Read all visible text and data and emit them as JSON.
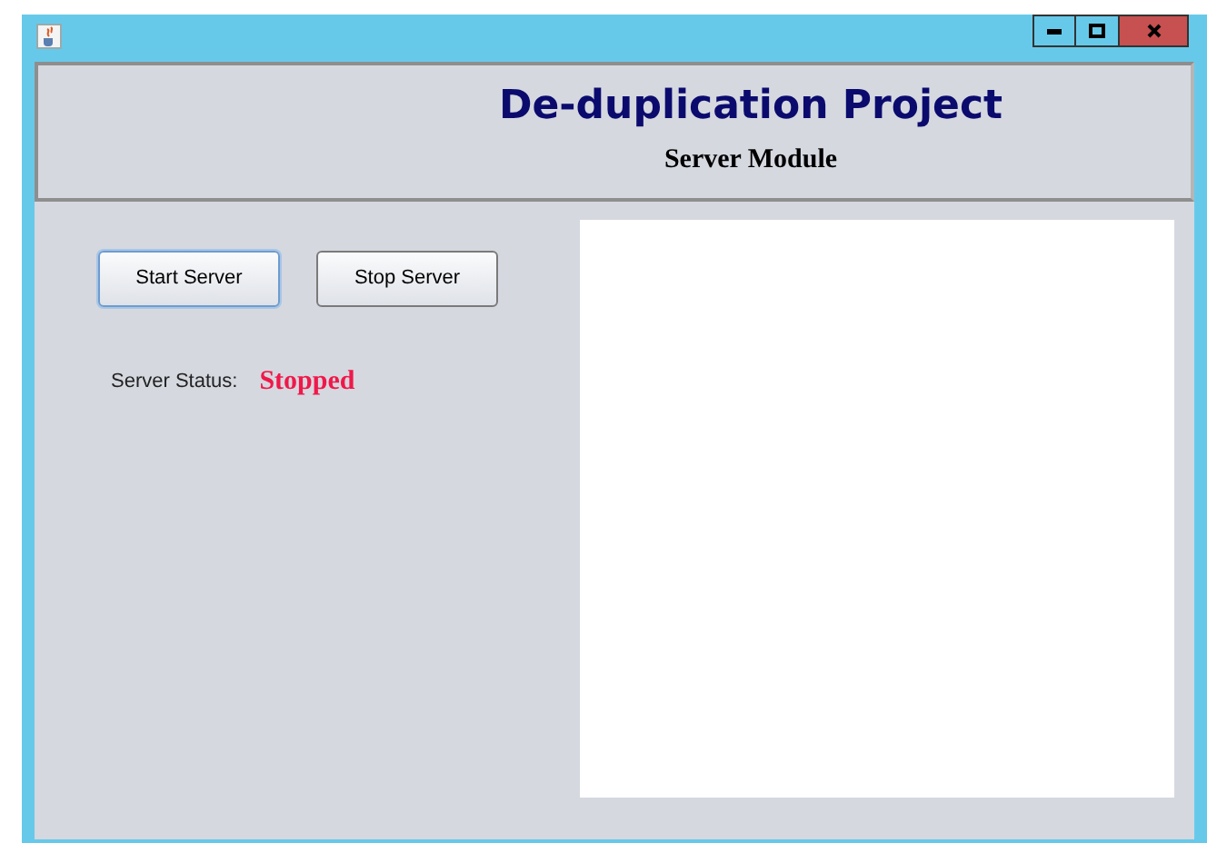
{
  "header": {
    "title": "De-duplication Project",
    "subtitle": "Server Module"
  },
  "buttons": [
    {
      "label": "Start Server",
      "focused": true
    },
    {
      "label": "Stop Server",
      "focused": false
    }
  ],
  "status": {
    "label": "Server Status:",
    "value": "Stopped"
  }
}
